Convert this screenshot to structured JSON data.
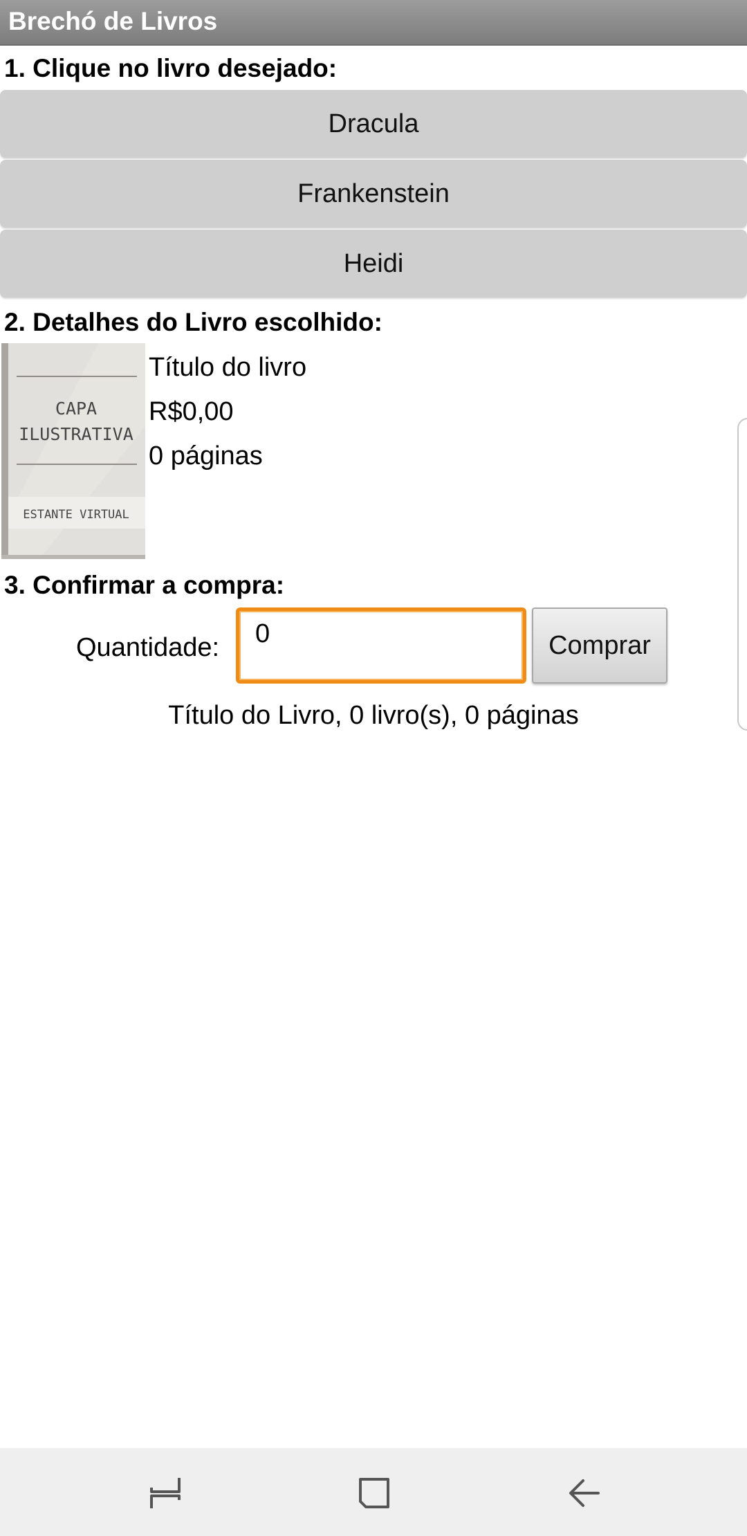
{
  "app": {
    "title": "Brechó de Livros"
  },
  "step1": {
    "label": "1. Clique no livro desejado:",
    "books": [
      "Dracula",
      "Frankenstein",
      "Heidi"
    ]
  },
  "step2": {
    "label": "2. Detalhes do Livro escolhido:",
    "cover": {
      "line1": "CAPA",
      "line2": "ILUSTRATIVA",
      "footer": "ESTANTE VIRTUAL"
    },
    "title": "Título do livro",
    "price": "R$0,00",
    "pages": "0 páginas"
  },
  "step3": {
    "label": "3. Confirmar a compra:",
    "quantity_label": "Quantidade:",
    "quantity_value": "0",
    "buy_label": "Comprar",
    "summary": "Título do Livro, 0 livro(s), 0 páginas"
  },
  "nav": {
    "icons": [
      "recent-apps-icon",
      "home-icon",
      "back-icon"
    ]
  },
  "colors": {
    "title_bar": "#8a8a8a",
    "book_button": "#cfcfcf",
    "input_focus": "#f08c16",
    "nav_bar": "#efefef"
  }
}
